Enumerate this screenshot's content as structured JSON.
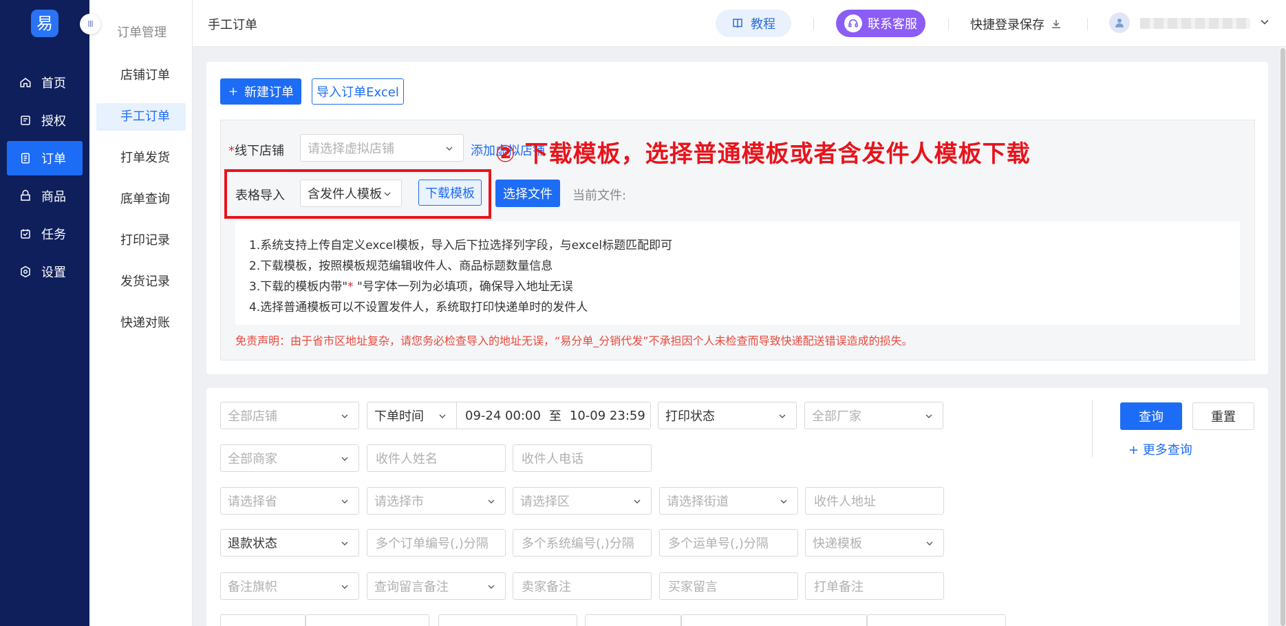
{
  "sidebar": {
    "logo": "易",
    "items": [
      {
        "label": "首页",
        "icon": "home-icon"
      },
      {
        "label": "授权",
        "icon": "authorize-icon"
      },
      {
        "label": "订单",
        "icon": "order-icon"
      },
      {
        "label": "商品",
        "icon": "goods-icon"
      },
      {
        "label": "任务",
        "icon": "task-icon"
      },
      {
        "label": "设置",
        "icon": "settings-icon"
      }
    ]
  },
  "subnav": {
    "collapse_glyph": "III",
    "title": "订单管理",
    "items": [
      "店铺订单",
      "手工订单",
      "打单发货",
      "底单查询",
      "打印记录",
      "发货记录",
      "快递对账"
    ]
  },
  "header": {
    "title": "手工订单",
    "tutorial": "教程",
    "service": "联系客服",
    "quick_save": "快捷登录保存"
  },
  "toolbar": {
    "new_order": "新建订单",
    "import_excel": "导入订单Excel"
  },
  "import_form": {
    "shop_label": "线下店铺",
    "shop_required_mark": "*",
    "shop_placeholder": "请选择虚拟店铺",
    "add_shop_link": "添加虚拟店铺",
    "table_import_label": "表格导入",
    "template_value": "含发件人模板",
    "download_template": "下载模板",
    "choose_file": "选择文件",
    "current_file_label": "当前文件:",
    "annotation": "② 下载模板，选择普通模板或者含发件人模板下载"
  },
  "instructions": [
    "1.系统支持上传自定义excel模板，导入后下拉选择列字段，与excel标题匹配即可",
    "2.下载模板，按照模板规范编辑收件人、商品标题数量信息",
    "3.下载的模板内带\"",
    "*",
    " \"号字体一列为必填项，确保导入地址无误",
    "4.选择普通模板可以不设置发件人，系统取打印快递单时的发件人"
  ],
  "disclaimer": "免责声明：由于省市区地址复杂，请您务必检查导入的地址无误，“易分单_分销代发”不承担因个人未检查而导致快递配送错误造成的损失。",
  "filters": {
    "all_shops": "全部店铺",
    "order_time": "下单时间",
    "date_start": "09-24 00:00",
    "date_sep": "至",
    "date_end": "10-09 23:59",
    "print_status": "打印状态",
    "all_factories": "全部厂家",
    "all_merchants": "全部商家",
    "receiver_name": "收件人姓名",
    "receiver_phone": "收件人电话",
    "province": "请选择省",
    "city": "请选择市",
    "district": "请选择区",
    "street": "请选择街道",
    "receiver_address": "收件人地址",
    "refund_status": "退款状态",
    "order_nos": "多个订单编号(,)分隔",
    "system_nos": "多个系统编号(,)分隔",
    "waybill_nos": "多个运单号(,)分隔",
    "express_template": "快递模板",
    "remark_flag": "备注旗帜",
    "query_remark": "查询留言备注",
    "seller_remark": "卖家备注",
    "buyer_message": "买家留言",
    "print_remark": "打单备注",
    "search": "查询",
    "reset": "重置",
    "more_query": "+ 更多查询"
  },
  "colors": {
    "sidebar_bg": "#0f1f5c",
    "primary": "#1d6cf5",
    "annotation_red": "#e8141c",
    "service_purple": "#8b5cf6"
  }
}
